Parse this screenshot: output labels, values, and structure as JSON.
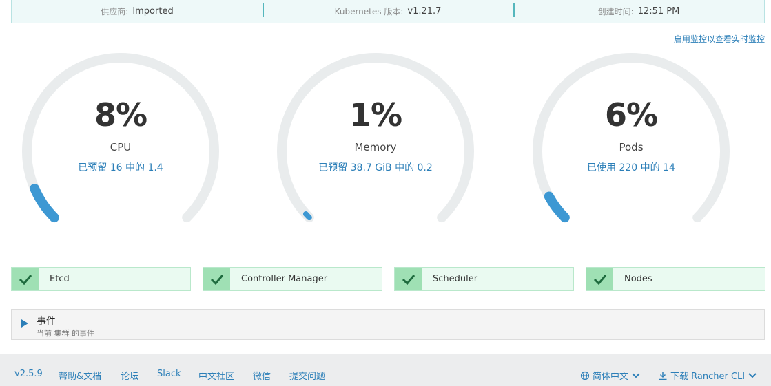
{
  "info": {
    "provider_label": "供应商:",
    "provider_value": "Imported",
    "k8s_label": "Kubernetes 版本:",
    "k8s_value": "v1.21.7",
    "created_label": "创建时间:",
    "created_value": "12:51 PM"
  },
  "monitor_link": "启用监控以查看实时监控",
  "gauges": [
    {
      "value": "8%",
      "name": "CPU",
      "detail": "已预留 16 中的 1.4",
      "percent": 0.08
    },
    {
      "value": "1%",
      "name": "Memory",
      "detail": "已预留 38.7 GiB 中的 0.2",
      "percent": 0.01
    },
    {
      "value": "6%",
      "name": "Pods",
      "detail": "已使用 220 中的 14",
      "percent": 0.06
    }
  ],
  "components": [
    {
      "label": "Etcd",
      "status": "healthy"
    },
    {
      "label": "Controller Manager",
      "status": "healthy"
    },
    {
      "label": "Scheduler",
      "status": "healthy"
    },
    {
      "label": "Nodes",
      "status": "healthy"
    }
  ],
  "events": {
    "title": "事件",
    "subtitle": "当前 集群 的事件"
  },
  "footer": {
    "version": "v2.5.9",
    "help": "帮助&文档",
    "forum": "论坛",
    "slack": "Slack",
    "community": "中文社区",
    "wechat": "微信",
    "issue": "提交问题",
    "language": "简体中文",
    "download": "下载 Rancher CLI"
  },
  "colors": {
    "accent": "#2c7fb8",
    "gauge_track": "#e9eced",
    "gauge_fill": "#3d98d3",
    "healthy": "#9fe0b4"
  }
}
